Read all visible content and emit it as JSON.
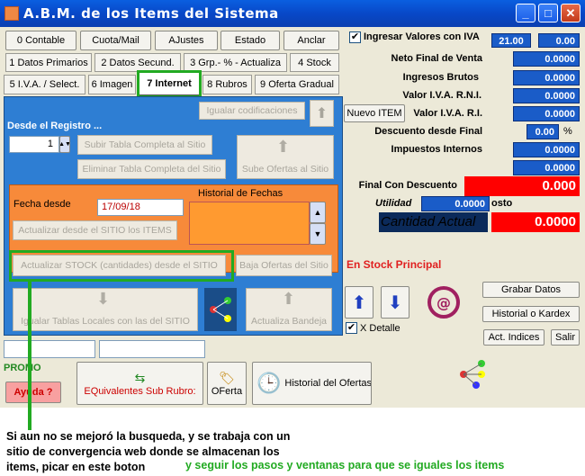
{
  "window": {
    "title": "A.B.M. de los Items del Sistema",
    "controls": [
      "_",
      "□",
      "✕"
    ]
  },
  "tabs_row1": [
    "0 Contable",
    "Cuota/Mail",
    "AJustes",
    "Estado",
    "Anclar"
  ],
  "tabs_row2": [
    "1 Datos Primarios",
    "2 Datos Secund.",
    "3 Grp.- % - Actualiza",
    "4 Stock"
  ],
  "tabs_row3": [
    "5 I.V.A. / Select.",
    "6 Imagen",
    "7 Internet",
    "8 Rubros",
    "9 Oferta Gradual"
  ],
  "internet": {
    "igualar_codificaciones": "Igualar codificaciones",
    "desde_registro": "Desde el Registro ...",
    "registro_value": "1",
    "subir_tabla": "Subir Tabla Completa al Sitio",
    "eliminar_tabla": "Eliminar Tabla Completa del Sitio",
    "sube_ofertas": "Sube Ofertas al Sitio",
    "fecha_desde_label": "Fecha desde",
    "fecha_desde_value": "17/09/18",
    "historial_fechas": "Historial de Fechas",
    "actualizar_desde_sitio": "Actualizar  desde el SITIO los ITEMS",
    "actualizar_stock": "Actualizar  STOCK (cantidades) desde el SITIO",
    "baja_ofertas": "Baja Ofertas del Sitio",
    "igualar_tablas": "Igualar Tablas Locales con las del SITIO",
    "actualiza_bandeja": "Actualiza Bandeja"
  },
  "right": {
    "ingresar_valores": "Ingresar Valores con IVA",
    "iva_rate": "21.00",
    "iva_total": "0.00",
    "neto_final_label": "Neto Final de Venta",
    "neto_final": "0.0000",
    "ingresos_brutos_label": "Ingresos Brutos",
    "ingresos_brutos": "0.0000",
    "valor_iva_rni_label": "Valor I.V.A. R.N.I.",
    "valor_iva_rni": "0.0000",
    "nuevo_item": "Nuevo ITEM",
    "valor_iva_ri_label": "Valor I.V.A. R.I.",
    "valor_iva_ri": "0.0000",
    "descuento_label": "Descuento desde Final",
    "descuento": "0.00",
    "descuento_unit": "%",
    "impuestos_label": "Impuestos Internos",
    "impuestos": "0.0000",
    "extra_value": "0.0000",
    "final_descuento_label": "Final Con Descuento",
    "final_descuento": "0.000",
    "utilidad_label": "Utilidad",
    "utilidad_value": "0.0000",
    "utilidad_suffix": "osto",
    "cantidad_label": "Cantidad Actual",
    "cantidad_value": "0.0000",
    "stock_principal": "En Stock Principal",
    "grabar": "Grabar Datos",
    "historial_kardex": "Historial o Kardex",
    "x_detalle": "X Detalle",
    "act_indices": "Act. Indices",
    "salir": "Salir"
  },
  "bottom": {
    "promo": "PROMO",
    "ayuda": "Ayuda ?",
    "equivalentes": "EQuivalentes Sub Rubro:",
    "oferta": "OFerta",
    "historial_ofertas": "Historial del Ofertas"
  },
  "annotations": {
    "caption_black_1": "Si aun no se mejoró la busqueda, y se trabaja con un",
    "caption_black_2": "sitio de convergencia web donde se almacenan los",
    "caption_black_3": "items, picar en este boton",
    "caption_green": "y seguir los pasos y ventanas para que se iguales los items"
  }
}
